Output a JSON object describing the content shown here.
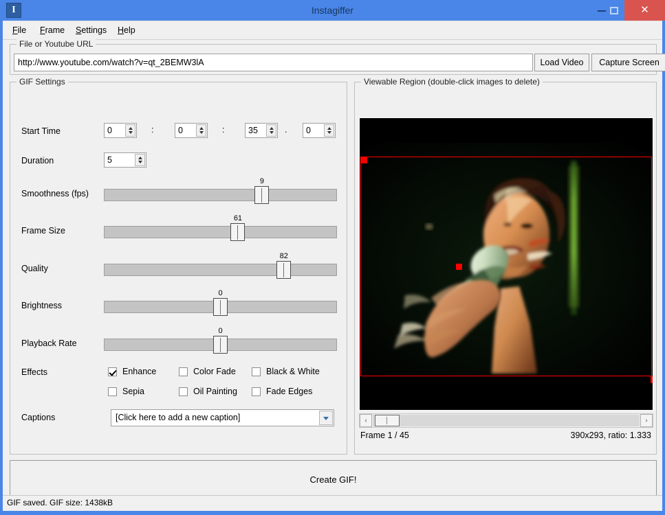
{
  "window": {
    "title": "Instagiffer",
    "icon": "I",
    "controls": {
      "minimize": "minimize-icon",
      "maximize": "maximize-icon",
      "close": "✕"
    }
  },
  "menubar": {
    "items": [
      {
        "label": "File",
        "accel": "F"
      },
      {
        "label": "Frame",
        "accel": "F"
      },
      {
        "label": "Settings",
        "accel": "S"
      },
      {
        "label": "Help",
        "accel": "H"
      }
    ]
  },
  "url_group": {
    "title": "File or Youtube URL",
    "url_value": "http://www.youtube.com/watch?v=qt_2BEMW3lA",
    "url_placeholder": "File or Youtube URL",
    "load_button": "Load Video",
    "capture_button": "Capture Screen"
  },
  "gif_settings": {
    "title": "GIF Settings",
    "start_time": {
      "label": "Start Time",
      "hours": "0",
      "minutes": "0",
      "seconds": "35",
      "fraction": "0",
      "sep_colon": ":",
      "sep_dot": "."
    },
    "duration": {
      "label": "Duration",
      "value": "5"
    },
    "sliders": [
      {
        "label": "Smoothness (fps)",
        "value": "9",
        "pos_pct": 69
      },
      {
        "label": "Frame Size",
        "value": "61",
        "pos_pct": 58
      },
      {
        "label": "Quality",
        "value": "82",
        "pos_pct": 79
      },
      {
        "label": "Brightness",
        "value": "0",
        "pos_pct": 50
      },
      {
        "label": "Playback Rate",
        "value": "0",
        "pos_pct": 50
      }
    ],
    "effects": {
      "label": "Effects",
      "items": [
        {
          "label": "Enhance",
          "checked": true
        },
        {
          "label": "Color Fade",
          "checked": false
        },
        {
          "label": "Black & White",
          "checked": false
        },
        {
          "label": "Sepia",
          "checked": false
        },
        {
          "label": "Oil Painting",
          "checked": false
        },
        {
          "label": "Fade Edges",
          "checked": false
        }
      ]
    },
    "captions": {
      "label": "Captions",
      "selected": "[Click here to add a new caption]"
    }
  },
  "viewable_region": {
    "title": "Viewable Region (double-click images to delete)",
    "frame_label": "Frame  1 / 45",
    "dimensions_label": "390x293, ratio: 1.333",
    "scroll_left": "‹",
    "scroll_right": "›",
    "crop_color": "#ff0000"
  },
  "create_button": {
    "label": "Create GIF!"
  },
  "statusbar": {
    "text": "GIF saved. GIF size: 1438kB"
  },
  "colors": {
    "title_bar": "#4a86e8",
    "close_button": "#d9534f",
    "panel_bg": "#f0f0f0",
    "crop_red": "#ff0000"
  }
}
